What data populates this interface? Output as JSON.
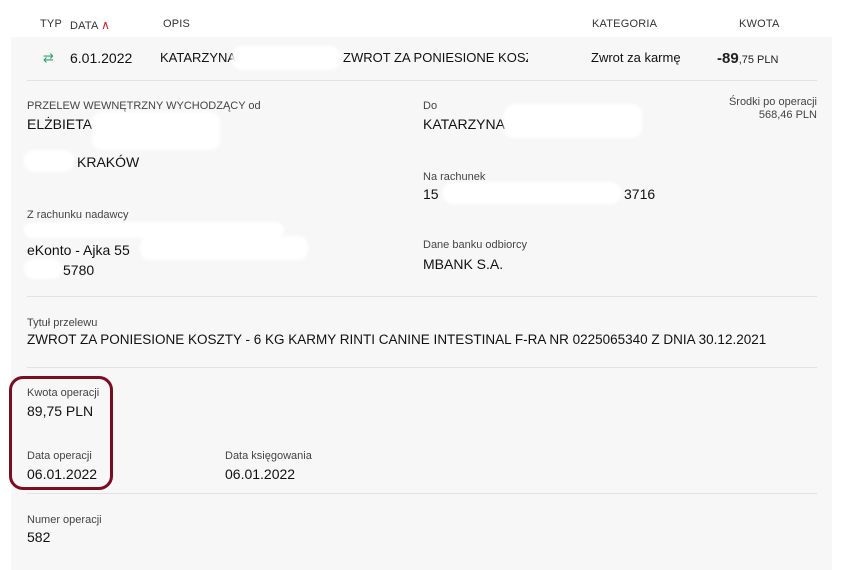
{
  "header": {
    "col_type": "TYP",
    "col_date": "DATA",
    "col_desc": "OPIS",
    "col_category": "KATEGORIA",
    "col_amount": "KWOTA"
  },
  "transaction_row": {
    "date": "6.01.2022",
    "recipient": "KATARZYNA",
    "description": "ZWROT ZA PONIESIONE KOSZTʸ",
    "category": "Zwrot za karmę",
    "amount_int": "-89",
    "amount_dec": ",75 PLN"
  },
  "details": {
    "sender_label": "PRZELEW WEWNĘTRZNY WYCHODZĄCY od",
    "sender_name": "ELŻBIETA",
    "sender_city": "KRAKÓW",
    "to_label": "Do",
    "to_name": "KATARZYNA",
    "funds_after_label": "Środki po operacji",
    "funds_after_value": "568,46 PLN",
    "to_account_label": "Na rachunek",
    "to_account_prefix": "15",
    "to_account_suffix": "3716",
    "from_account_label": "Z rachunku nadawcy",
    "from_account_name": "eKonto - Ajka 55",
    "from_account_suffix": "5780",
    "bank_label": "Dane banku odbiorcy",
    "bank_name": "MBANK S.A.",
    "title_label": "Tytuł przelewu",
    "title_value": "ZWROT ZA PONIESIONE KOSZTY - 6 KG KARMY RINTI CANINE INTESTINAL F-RA NR 0225065340 Z DNIA 30.12.2021",
    "amount_label": "Kwota operacji",
    "amount_value": "89,75 PLN",
    "op_date_label": "Data operacji",
    "op_date_value": "06.01.2022",
    "booking_date_label": "Data księgowania",
    "booking_date_value": "06.01.2022",
    "op_number_label": "Numer operacji",
    "op_number_value": "582"
  },
  "colors": {
    "accent_red": "#d21f26",
    "highlight_border": "#7a0d22",
    "transfer_icon": "#2fa36b"
  }
}
